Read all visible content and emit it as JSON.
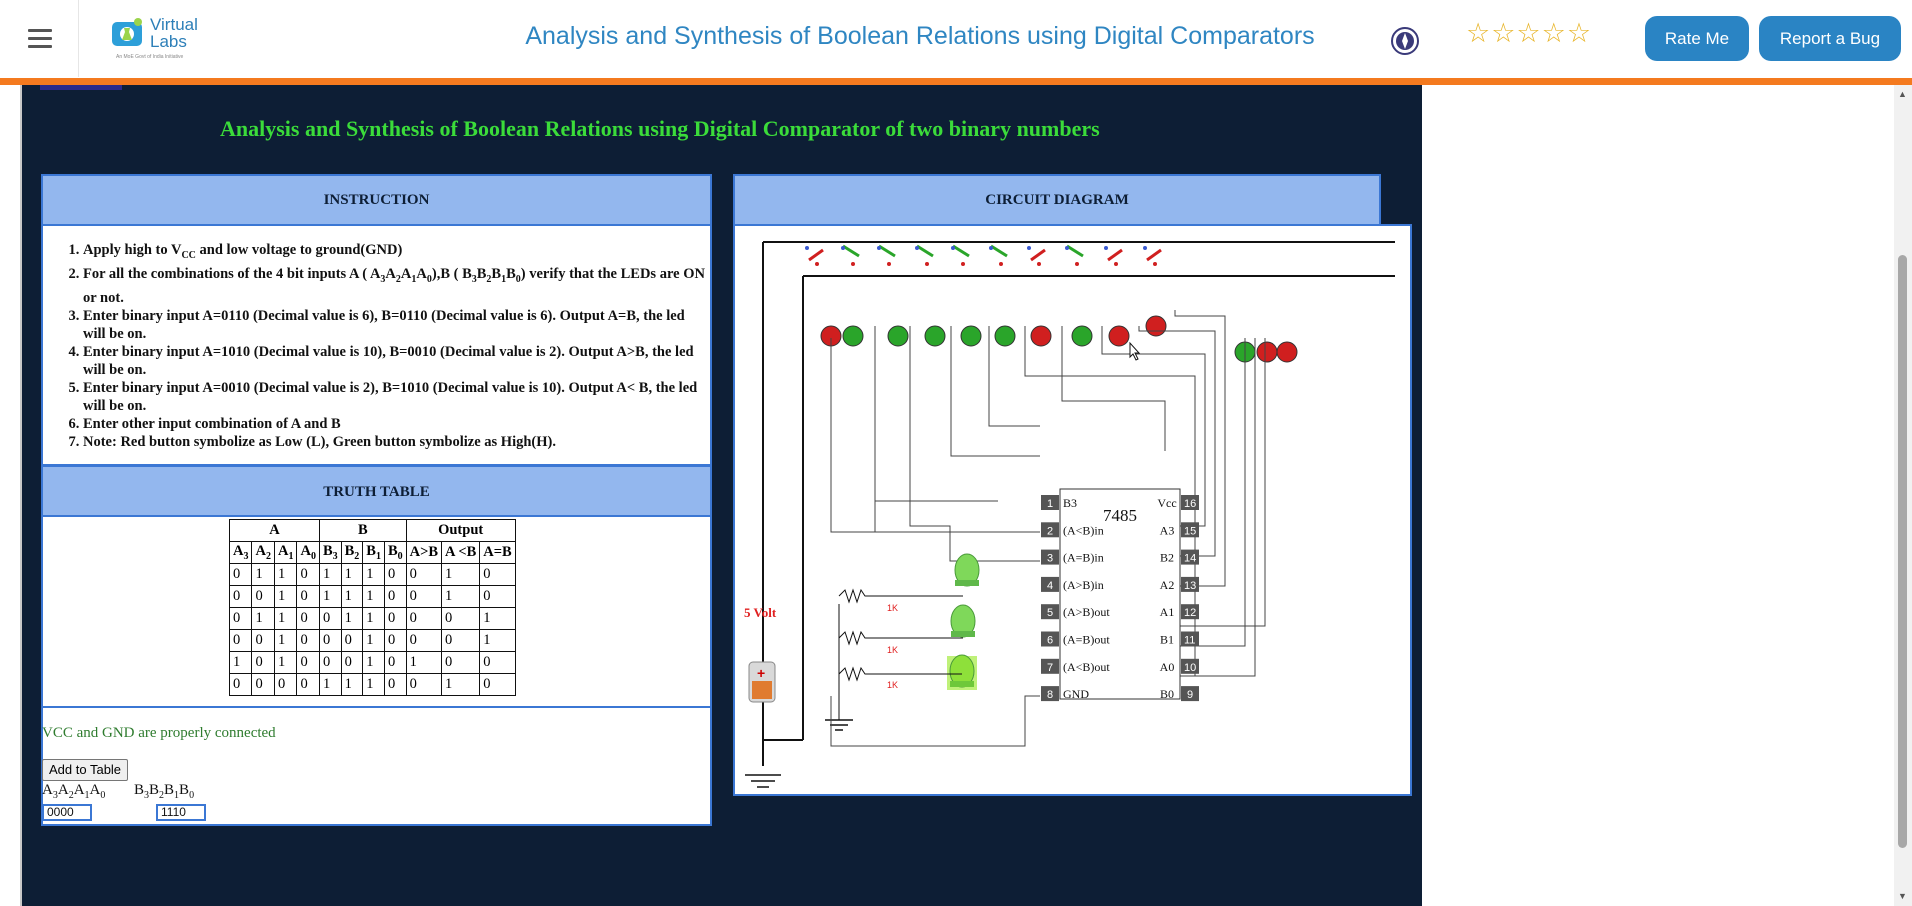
{
  "header": {
    "logo_text": "Virtual Labs",
    "logo_sub": "An MoE Govt of India Initiative",
    "title": "Analysis and Synthesis of Boolean Relations using Digital Comparators",
    "stars": "☆☆☆☆☆",
    "rate_label": "Rate Me",
    "bug_label": "Report a Bug"
  },
  "sim": {
    "title": "Analysis and Synthesis of Boolean Relations using Digital Comparator of two binary numbers",
    "instruction_head": "INSTRUCTION",
    "circuit_head": "CIRCUIT DIAGRAM",
    "truth_head": "TRUTH TABLE",
    "instructions": [
      "Apply high to V<sub>CC</sub> and low voltage to ground(GND)",
      "For all the combinations of the 4 bit inputs A ( A<sub>3</sub>A<sub>2</sub>A<sub>1</sub>A<sub>0</sub>),B ( B<sub>3</sub>B<sub>2</sub>B<sub>1</sub>B<sub>0</sub>) verify that the LEDs are ON or not.",
      "Enter binary input A=0110 (Decimal value is 6), B=0110 (Decimal value is 6). Output A=B, the led will be on.",
      "Enter binary input A=1010 (Decimal value is 10), B=0010 (Decimal value is 2). Output A>B, the led will be on.",
      "Enter binary input A=0010 (Decimal value is 2), B=1010 (Decimal value is 10). Output A< B, the led will be on.",
      "Enter other input combination of A and B",
      "Note: Red button symbolize as Low (L), Green button symbolize as High(H)."
    ],
    "truth_table": {
      "group_headers": [
        "A",
        "B",
        "Output"
      ],
      "col_headers": [
        "A3",
        "A2",
        "A1",
        "A0",
        "B3",
        "B2",
        "B1",
        "B0",
        "A>B",
        "A <B",
        "A=B"
      ],
      "rows": [
        [
          "0",
          "1",
          "1",
          "0",
          "1",
          "1",
          "1",
          "0",
          "0",
          "1",
          "0"
        ],
        [
          "0",
          "0",
          "1",
          "0",
          "1",
          "1",
          "1",
          "0",
          "0",
          "1",
          "0"
        ],
        [
          "0",
          "1",
          "1",
          "0",
          "0",
          "1",
          "1",
          "0",
          "0",
          "0",
          "1"
        ],
        [
          "0",
          "0",
          "1",
          "0",
          "0",
          "0",
          "1",
          "0",
          "0",
          "0",
          "1"
        ],
        [
          "1",
          "0",
          "1",
          "0",
          "0",
          "0",
          "1",
          "0",
          "1",
          "0",
          "0"
        ],
        [
          "0",
          "0",
          "0",
          "0",
          "1",
          "1",
          "1",
          "0",
          "0",
          "1",
          "0"
        ]
      ]
    },
    "status": "VCC and GND are properly connected",
    "add_button": "Add to Table",
    "input_a_label": "A3A2A1A0",
    "input_b_label": "B3B2B1B0",
    "input_a_value": "0000",
    "input_b_value": "1110"
  },
  "circuit": {
    "ic_label": "7485",
    "voltage_label": "5 Volt",
    "resistor_label": "1K",
    "left_pins": [
      {
        "num": "1",
        "name": "B3"
      },
      {
        "num": "2",
        "name": "(A<B)in"
      },
      {
        "num": "3",
        "name": "(A=B)in"
      },
      {
        "num": "4",
        "name": "(A>B)in"
      },
      {
        "num": "5",
        "name": "(A>B)out"
      },
      {
        "num": "6",
        "name": "(A=B)out"
      },
      {
        "num": "7",
        "name": "(A<B)out"
      },
      {
        "num": "8",
        "name": "GND"
      }
    ],
    "right_pins": [
      {
        "num": "16",
        "name": "Vcc"
      },
      {
        "num": "15",
        "name": "A3"
      },
      {
        "num": "14",
        "name": "B2"
      },
      {
        "num": "13",
        "name": "A2"
      },
      {
        "num": "12",
        "name": "A1"
      },
      {
        "num": "11",
        "name": "B1"
      },
      {
        "num": "10",
        "name": "A0"
      },
      {
        "num": "9",
        "name": "B0"
      }
    ],
    "switch_states": [
      "low",
      "high",
      "high",
      "high",
      "high",
      "high",
      "low",
      "high",
      "low",
      "low"
    ],
    "colors": {
      "high": "#2aa52a",
      "low": "#d01f1f",
      "led_on": "#8ee03a",
      "led_off": "#6fbf4f"
    }
  },
  "colors": {
    "accent": "#2a84c4",
    "header_bar": "#f47a1f",
    "panel_bg": "#0d1e35",
    "sim_title": "#3bdc3a"
  }
}
